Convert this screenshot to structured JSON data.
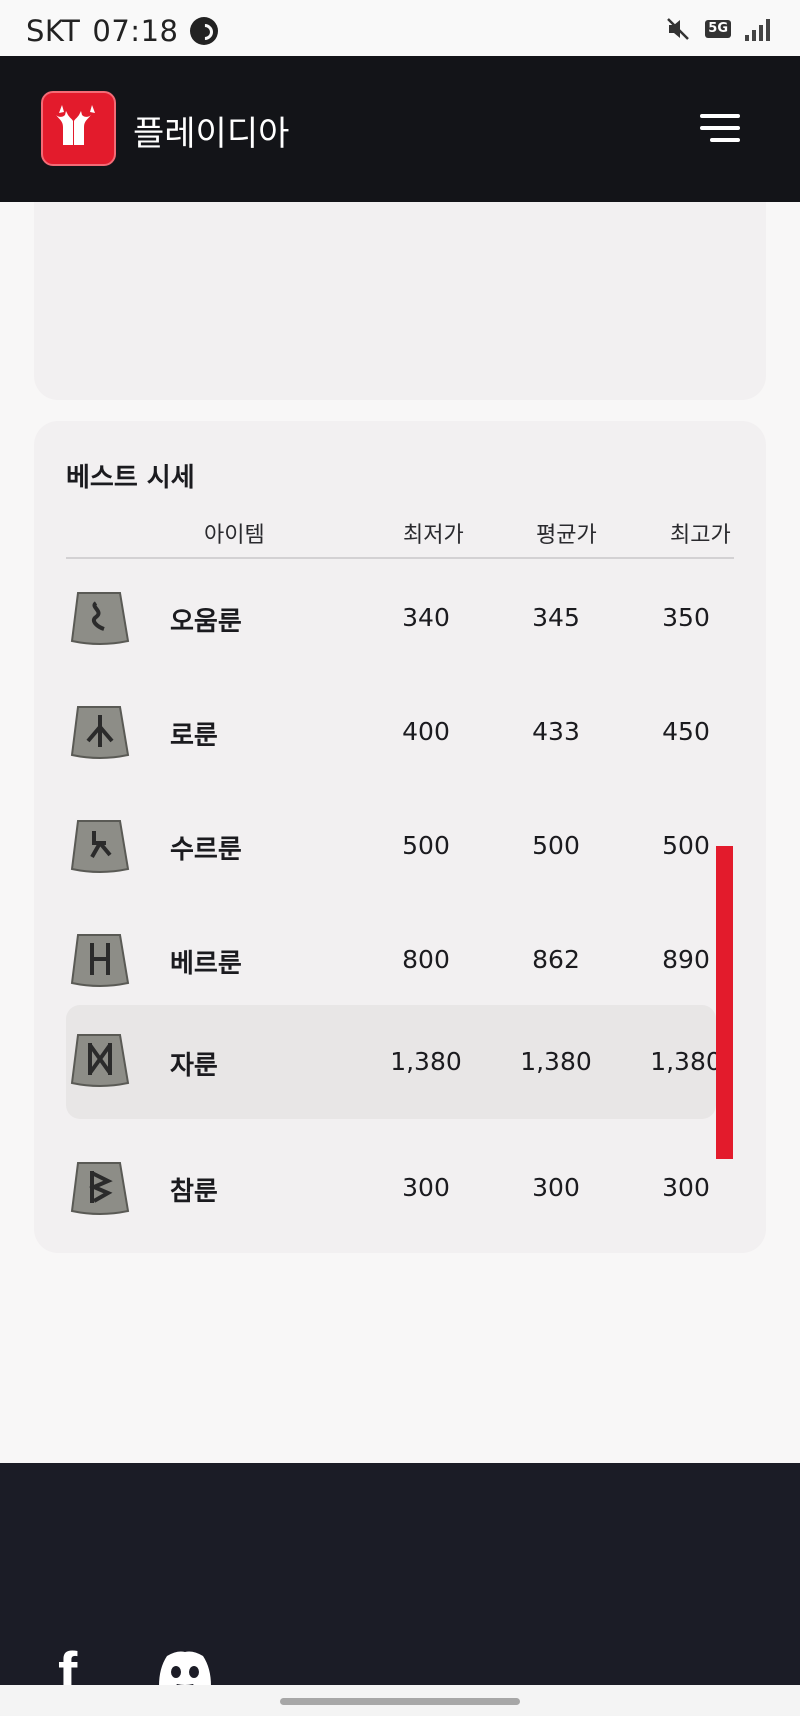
{
  "status_bar": {
    "carrier": "SKT",
    "time": "07:18",
    "network": "5G"
  },
  "header": {
    "brand": "플레이디아",
    "icons": [
      "logo-icon",
      "menu-icon"
    ]
  },
  "price_table": {
    "title": "베스트 시세",
    "columns": [
      "아이템",
      "최저가",
      "평균가",
      "최고가"
    ],
    "rows": [
      {
        "name": "오움룬",
        "min": "340",
        "avg": "345",
        "max": "350"
      },
      {
        "name": "로룬",
        "min": "400",
        "avg": "433",
        "max": "450"
      },
      {
        "name": "수르룬",
        "min": "500",
        "avg": "500",
        "max": "500"
      },
      {
        "name": "베르룬",
        "min": "800",
        "avg": "862",
        "max": "890"
      },
      {
        "name": "자룬",
        "min": "1,380",
        "avg": "1,380",
        "max": "1,380"
      },
      {
        "name": "참룬",
        "min": "300",
        "avg": "300",
        "max": "300"
      }
    ],
    "highlighted_row": "자룬"
  },
  "footer": {
    "icons": [
      "facebook-icon",
      "discord-icon"
    ]
  },
  "colors": {
    "brand_red": "#e31b2c",
    "header_bg": "#131418",
    "footer_bg": "#1b1c26",
    "card_bg": "#f2f0f1"
  }
}
